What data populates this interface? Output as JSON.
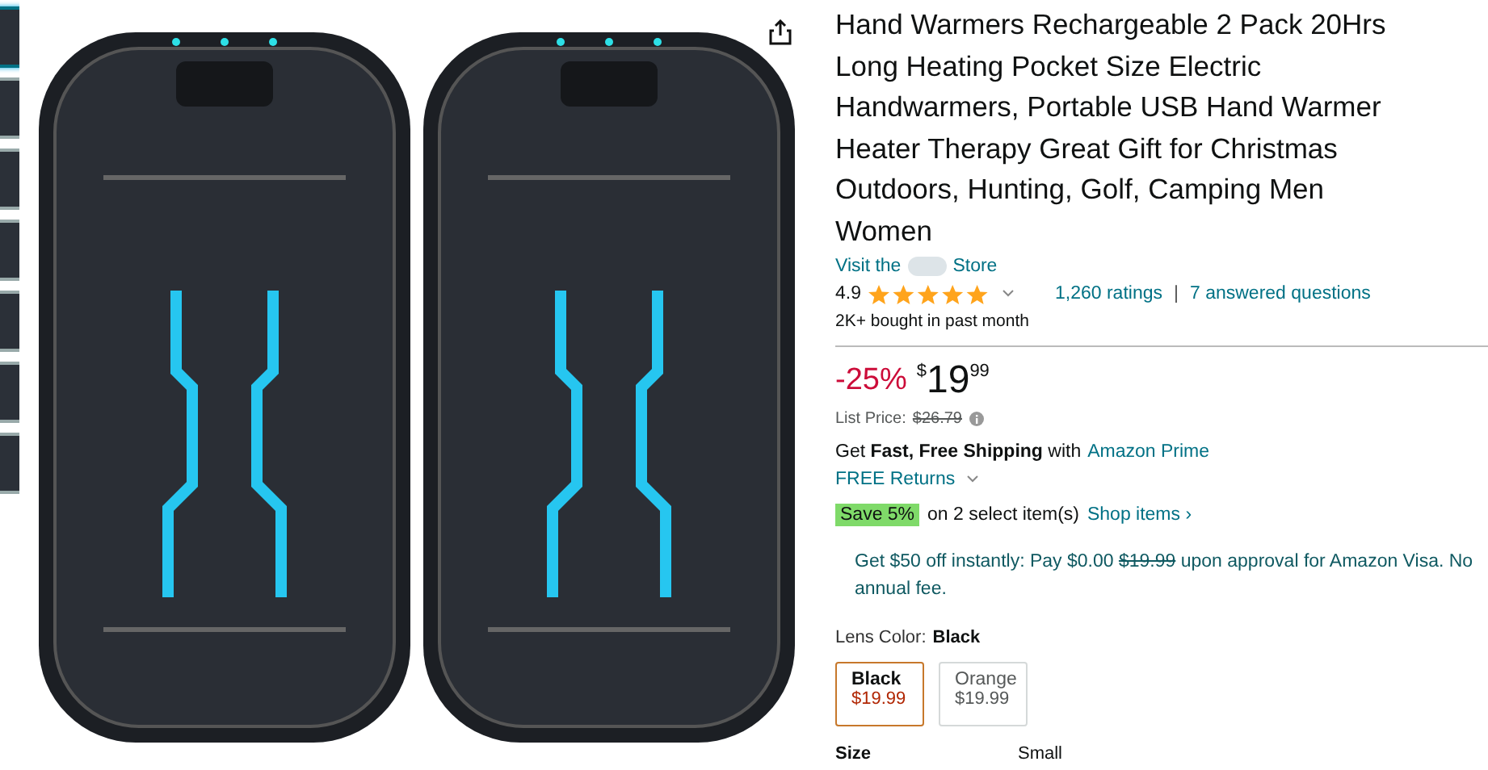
{
  "gallery": {
    "thumbnails": [
      {
        "selected": true
      },
      {
        "selected": false
      },
      {
        "selected": false
      },
      {
        "selected": false
      },
      {
        "selected": false
      },
      {
        "selected": false
      },
      {
        "selected": false
      }
    ]
  },
  "product": {
    "title": "Hand Warmers Rechargeable 2 Pack 20Hrs Long Heating Pocket Size Electric Handwarmers, Portable USB Hand Warmer Heater Therapy Great Gift for Christmas Outdoors, Hunting, Golf, Camping Men Women",
    "store_link": {
      "before": "Visit the",
      "after": "Store"
    },
    "rating": {
      "value": "4.9",
      "stars": 5,
      "ratings": "1,260 ratings",
      "separator": "|",
      "questions": "7 answered questions"
    },
    "bought": "2K+ bought in past month",
    "price": {
      "discount": "-25%",
      "currency": "$",
      "whole": "19",
      "fraction": "99",
      "list_label": "List Price:",
      "list_price": "$26.79"
    },
    "shipping": "Get **Fast, Free Shipping** with",
    "prime_link": "Amazon Prime",
    "returns": "FREE Returns",
    "coupon": {
      "badge": "Save 5%",
      "text": "on 2 select item(s)",
      "link": "Shop items ›"
    },
    "card_offer": {
      "text": "Get $50 off instantly: Pay $0.00",
      "old": "$19.99",
      "rest": "upon approval for Amazon Visa. No annual fee."
    },
    "lens_color": {
      "label": "Lens Color:",
      "value": "Black"
    },
    "swatches": [
      {
        "name": "Black",
        "price": "$19.99",
        "selected": true
      },
      {
        "name": "Orange",
        "price": "$19.99",
        "selected": false
      }
    ],
    "size": {
      "label": "Size",
      "value": "Small"
    }
  }
}
